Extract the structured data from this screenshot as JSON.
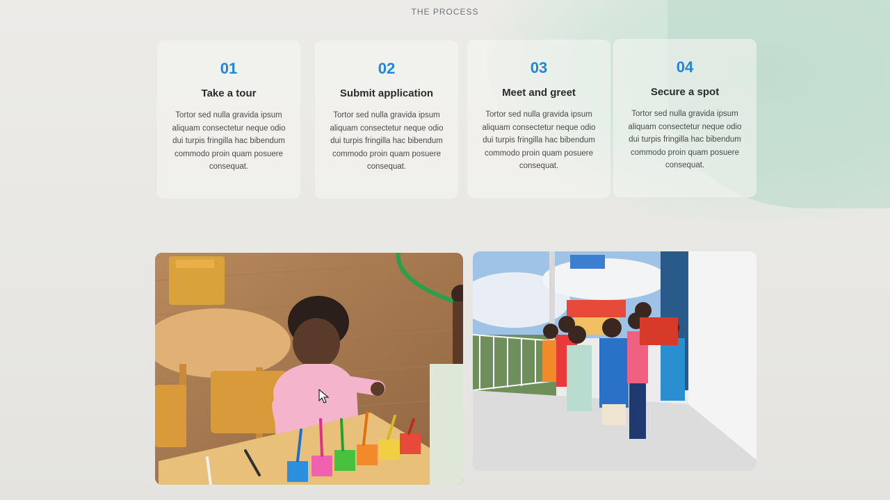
{
  "section": {
    "eyebrow": "THE PROCESS"
  },
  "steps": [
    {
      "number": "01",
      "title": "Take a tour",
      "description": "Tortor sed nulla gravida ipsum aliquam consectetur neque odio dui turpis fringilla hac bibendum commodo proin quam posuere consequat."
    },
    {
      "number": "02",
      "title": "Submit application",
      "description": "Tortor sed nulla gravida ipsum aliquam consectetur neque odio dui turpis fringilla hac bibendum commodo proin quam posuere consequat."
    },
    {
      "number": "03",
      "title": "Meet and greet",
      "description": "Tortor sed nulla gravida ipsum aliquam consectetur neque odio dui turpis fringilla hac bibendum commodo proin quam posuere consequat."
    },
    {
      "number": "04",
      "title": "Secure a spot",
      "description": "Tortor sed nulla gravida ipsum aliquam consectetur neque odio dui turpis fringilla hac bibendum commodo proin quam posuere consequat."
    }
  ],
  "images": [
    {
      "subject": "child sorting colored pencils at wooden classroom table"
    },
    {
      "subject": "group of children gathered on a balcony with a teacher"
    }
  ],
  "colors": {
    "accent": "#1f86d9",
    "heading": "#2b2b2b",
    "body": "#4a4a4a",
    "blob": "#c9e2d6"
  },
  "icons": {
    "cursor": "mouse-pointer-icon"
  }
}
